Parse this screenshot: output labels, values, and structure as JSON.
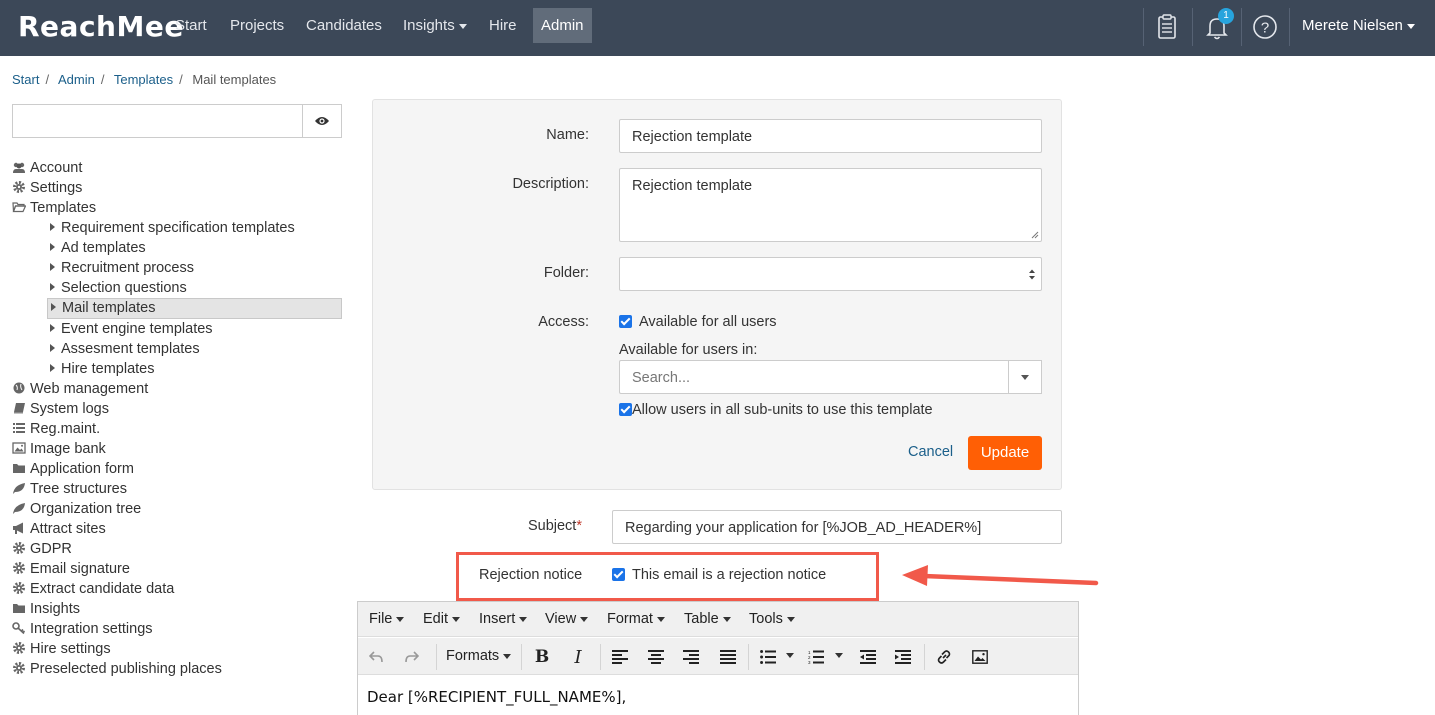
{
  "app": {
    "logo": "ReachMee",
    "nav": [
      "Start",
      "Projects",
      "Candidates",
      "Insights",
      "Hire",
      "Admin"
    ],
    "active_nav": "Admin",
    "notification_count": "1",
    "user_name": "Merete Nielsen"
  },
  "breadcrumb": [
    "Start",
    "Admin",
    "Templates",
    "Mail templates"
  ],
  "sidebar": {
    "search_value": "",
    "items": [
      {
        "label": "Account",
        "icon": "users-icon"
      },
      {
        "label": "Settings",
        "icon": "gear-icon"
      },
      {
        "label": "Templates",
        "icon": "folder-open-icon"
      },
      {
        "label": "Requirement specification templates",
        "sub": true
      },
      {
        "label": "Ad templates",
        "sub": true
      },
      {
        "label": "Recruitment process",
        "sub": true
      },
      {
        "label": "Selection questions",
        "sub": true
      },
      {
        "label": "Mail templates",
        "sub": true,
        "selected": true
      },
      {
        "label": "Event engine templates",
        "sub": true
      },
      {
        "label": "Assesment templates",
        "sub": true
      },
      {
        "label": "Hire templates",
        "sub": true
      },
      {
        "label": "Web management",
        "icon": "globe-icon"
      },
      {
        "label": "System logs",
        "icon": "book-icon"
      },
      {
        "label": "Reg.maint.",
        "icon": "list-icon"
      },
      {
        "label": "Image bank",
        "icon": "image-icon"
      },
      {
        "label": "Application form",
        "icon": "folder-icon"
      },
      {
        "label": "Tree structures",
        "icon": "leaf-icon"
      },
      {
        "label": "Organization tree",
        "icon": "leaf-icon"
      },
      {
        "label": "Attract sites",
        "icon": "bullhorn-icon"
      },
      {
        "label": "GDPR",
        "icon": "gear-icon"
      },
      {
        "label": "Email signature",
        "icon": "gear-icon"
      },
      {
        "label": "Extract candidate data",
        "icon": "gear-icon"
      },
      {
        "label": "Insights",
        "icon": "folder-icon"
      },
      {
        "label": "Integration settings",
        "icon": "key-icon"
      },
      {
        "label": "Hire settings",
        "icon": "gear-icon"
      },
      {
        "label": "Preselected publishing places",
        "icon": "gear-icon"
      }
    ]
  },
  "form": {
    "name_label": "Name:",
    "name_value": "Rejection template",
    "description_label": "Description:",
    "description_value": "Rejection template",
    "folder_label": "Folder:",
    "folder_value": "",
    "access_label": "Access:",
    "available_all_label": "Available for all users",
    "available_in_label": "Available for users in:",
    "search_placeholder": "Search...",
    "allow_subunits_label": "Allow users in all sub-units to use this template",
    "cancel_label": "Cancel",
    "update_label": "Update",
    "accent_color": "#ff5f05"
  },
  "mail": {
    "subject_label": "Subject",
    "subject_required": "*",
    "subject_value": "Regarding your application for [%JOB_AD_HEADER%]",
    "rejection_label": "Rejection notice",
    "rejection_checkbox_label": "This email is a rejection notice",
    "highlight_color": "#f1594a"
  },
  "editor": {
    "menu": [
      "File",
      "Edit",
      "Insert",
      "View",
      "Format",
      "Table",
      "Tools"
    ],
    "formats_label": "Formats",
    "content_first_line": "Dear [%RECIPIENT_FULL_NAME%],"
  }
}
